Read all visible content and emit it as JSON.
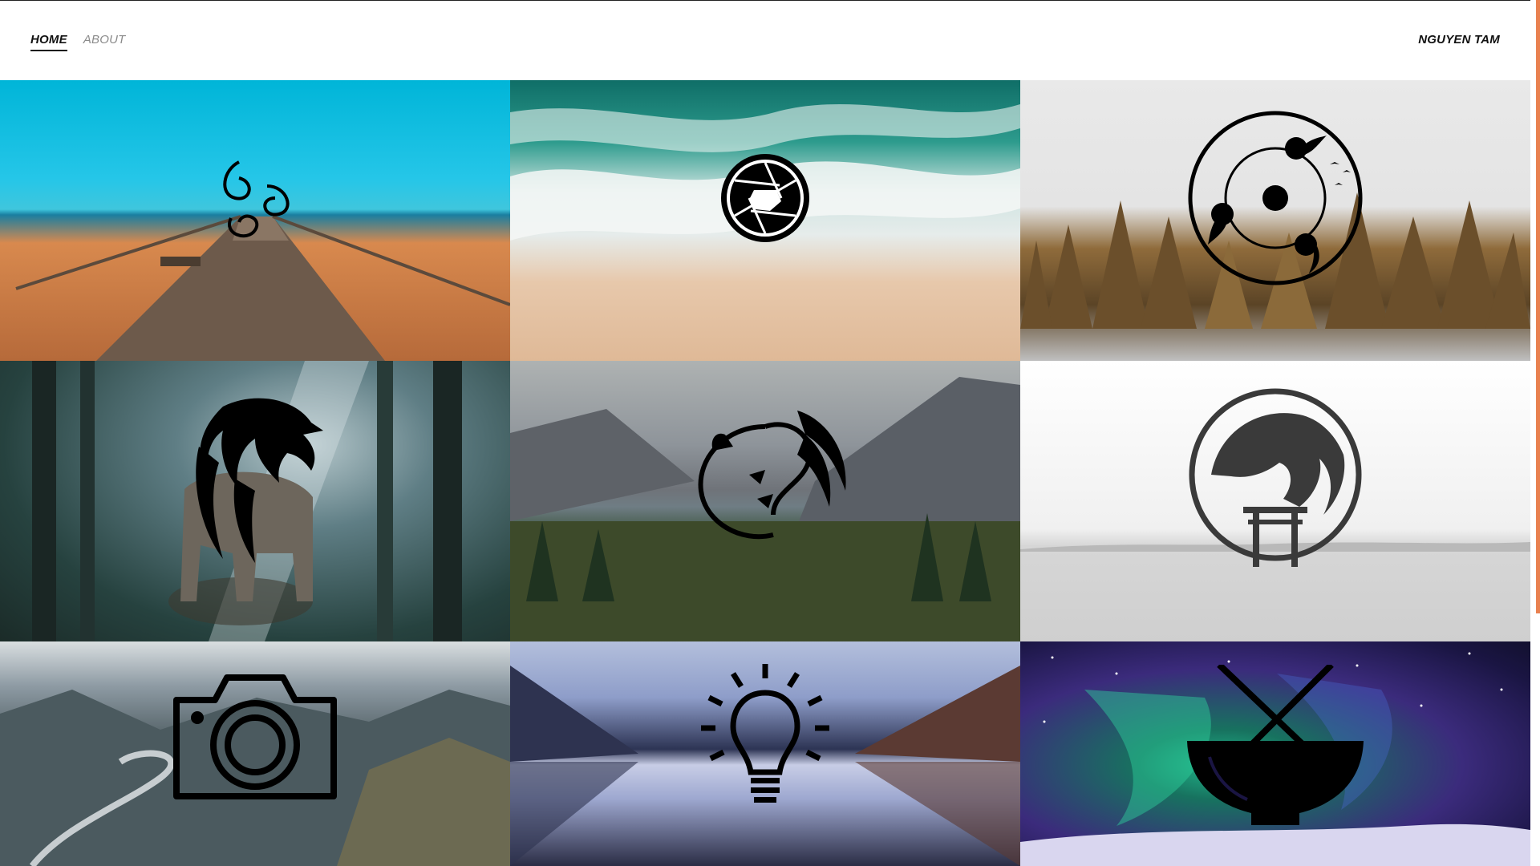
{
  "nav": {
    "items": [
      {
        "label": "HOME",
        "active": true
      },
      {
        "label": "ABOUT",
        "active": false
      }
    ]
  },
  "brand": {
    "name": "NGUYEN TAM"
  },
  "accent_color": "#e98150",
  "gallery": {
    "tiles": [
      {
        "scene": "pier-sea",
        "icon": "triple-swirl-icon"
      },
      {
        "scene": "beach-waves",
        "icon": "camera-shutter-icon"
      },
      {
        "scene": "forest-fog",
        "icon": "sharingan-icon"
      },
      {
        "scene": "elephant-forest",
        "icon": "eagle-head-icon"
      },
      {
        "scene": "mountain-lake",
        "icon": "dragon-icon"
      },
      {
        "scene": "misty-lake",
        "icon": "dragon-torii-icon"
      },
      {
        "scene": "mountain-river",
        "icon": "camera-icon"
      },
      {
        "scene": "lake-reflection",
        "icon": "light-bulb-icon"
      },
      {
        "scene": "aurora",
        "icon": "noodle-bowl-icon"
      }
    ]
  }
}
